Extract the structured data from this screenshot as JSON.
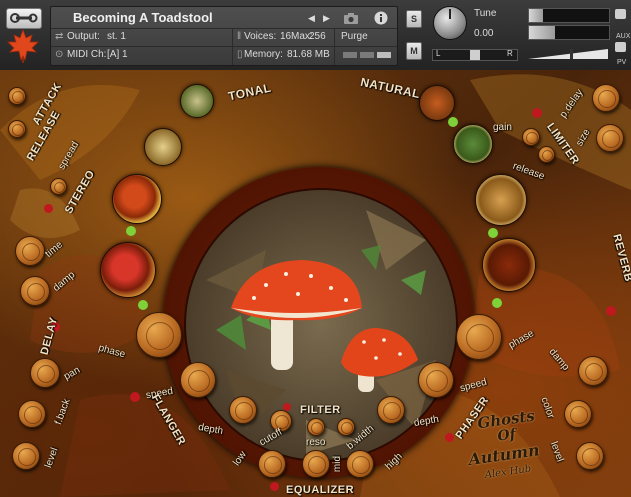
{
  "header": {
    "instrument_title": "Becoming A Toadstool",
    "output_label": "Output:",
    "output_value": "st. 1",
    "voices_label": "Voices:",
    "voices_value": "16",
    "max_label": "Max:",
    "max_value": "256",
    "purge_label": "Purge",
    "midi_label": "MIDI Ch:",
    "midi_value": "[A]  1",
    "memory_label": "Memory:",
    "memory_value": "81.68 MB",
    "solo_label": "S",
    "mute_label": "M",
    "tune_label": "Tune",
    "tune_value": "0.00",
    "pan_left": "L",
    "pan_right": "R",
    "aux_label": "AUX",
    "pv_label": "PV"
  },
  "panel": {
    "labels": {
      "attack": "ATTACK",
      "release_l": "RELEASE",
      "spread": "spread",
      "stereo": "STEREO",
      "time": "time",
      "damp_l": "damp",
      "delay": "DELAY",
      "phase_l": "phase",
      "pan": "pan",
      "fback": "f.back",
      "level_l": "level",
      "speed_l": "speed",
      "flanger": "FLANGER",
      "depth_l": "depth",
      "low": "low",
      "cutoff": "cutoff",
      "reso": "reso",
      "mid": "mid",
      "bwidth": "b.width",
      "high": "high",
      "filter": "FILTER",
      "equalizer": "EQUALIZER",
      "tonal": "TONAL",
      "natural": "NATURAL",
      "pdelay": "p.delay",
      "gain": "gain",
      "limiter": "LIMITER",
      "size": "size",
      "release_r": "release",
      "reverb": "REVERB",
      "phase_r": "phase",
      "damp_r": "damp",
      "speed_r": "speed",
      "depth_r": "depth",
      "phaser": "PHASER",
      "color": "color",
      "level_r": "level",
      "logo_line1": "Ghosts",
      "logo_line2": "Of",
      "logo_line3": "Autumn",
      "logo_author": "Alex Hub"
    },
    "led_on_color": "#7fd13a",
    "led_off_color": "#c0181f",
    "accent_color": "#f2e2c4"
  }
}
